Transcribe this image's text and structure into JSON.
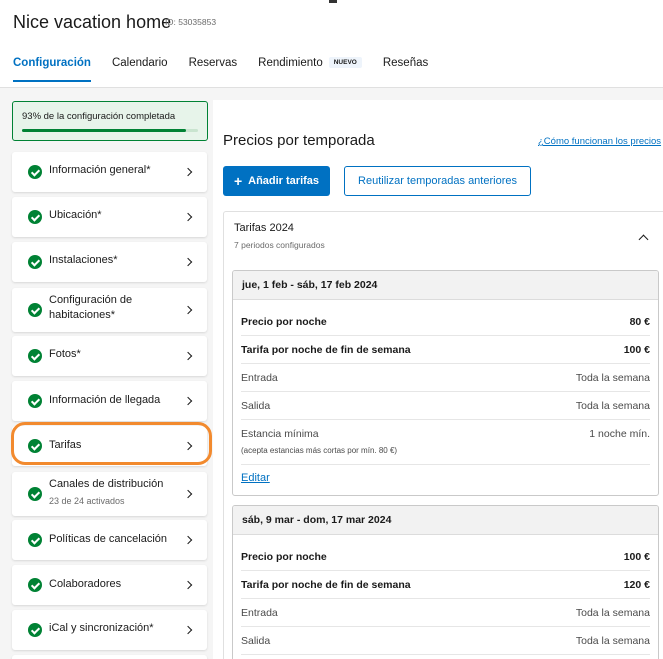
{
  "header": {
    "title": "Nice vacation home",
    "property_id": "ID: 53035853",
    "tabs": [
      {
        "label": "Configuración",
        "active": true
      },
      {
        "label": "Calendario"
      },
      {
        "label": "Reservas"
      },
      {
        "label": "Rendimiento",
        "badge": "NUEVO"
      },
      {
        "label": "Reseñas"
      }
    ]
  },
  "progress": {
    "text": "93% de la configuración completada",
    "percent": 93
  },
  "sidebar": {
    "items": [
      {
        "label": "Información general*"
      },
      {
        "label": "Ubicación*"
      },
      {
        "label": "Instalaciones*"
      },
      {
        "label": "Configuración de habitaciones*"
      },
      {
        "label": "Fotos*"
      },
      {
        "label": "Información de llegada"
      },
      {
        "label": "Tarifas",
        "highlighted": true
      },
      {
        "label": "Canales de distribución",
        "sub": "23 de 24 activados"
      },
      {
        "label": "Políticas de cancelación"
      },
      {
        "label": "Colaboradores"
      },
      {
        "label": "iCal y sincronización*"
      }
    ]
  },
  "main": {
    "title": "Precios por temporada",
    "help_link": "¿Cómo funcionan los precios",
    "add_button": "Añadir tarifas",
    "reuse_button": "Reutilizar temporadas anteriores",
    "group": {
      "title": "Tarifas 2024",
      "subtitle": "7 periodos configurados"
    },
    "seasons": [
      {
        "range": "jue, 1 feb - sáb, 17 feb 2024",
        "price_label": "Precio por noche",
        "price": "80 €",
        "weekend_label": "Tarifa por noche de fin de semana",
        "weekend_price": "100 €",
        "checkin_label": "Entrada",
        "checkin": "Toda la semana",
        "checkout_label": "Salida",
        "checkout": "Toda la semana",
        "minstay_label": "Estancia mínima",
        "minstay": "1 noche mín.",
        "minstay_note": "(acepta estancias más cortas por mín. 80 €)",
        "edit": "Editar"
      },
      {
        "range": "sáb, 9 mar - dom, 17 mar 2024",
        "price_label": "Precio por noche",
        "price": "100 €",
        "weekend_label": "Tarifa por noche de fin de semana",
        "weekend_price": "120 €",
        "checkin_label": "Entrada",
        "checkin": "Toda la semana",
        "checkout_label": "Salida",
        "checkout": "Toda la semana"
      }
    ]
  },
  "colors": {
    "primary": "#0071c2",
    "success": "#008234",
    "highlight": "#f28a2e"
  }
}
